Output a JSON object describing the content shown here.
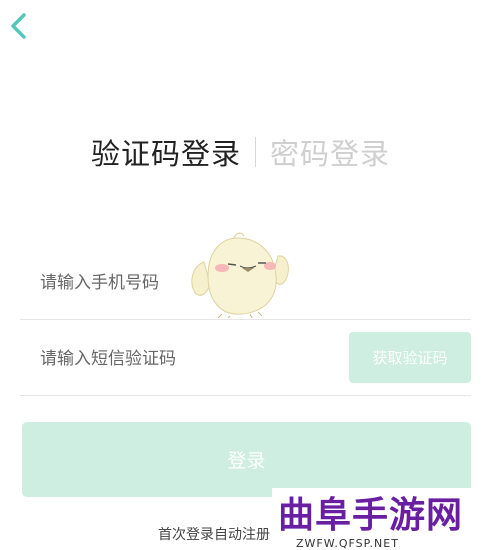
{
  "header": {
    "back_icon": "chevron-left-icon",
    "accent_color": "#54c8b8"
  },
  "tabs": [
    {
      "label": "验证码登录",
      "active": true
    },
    {
      "label": "密码登录",
      "active": false
    }
  ],
  "form": {
    "phone_placeholder": "请输入手机号码",
    "code_placeholder": "请输入短信验证码",
    "get_code_label": "获取验证码",
    "login_label": "登录",
    "button_color": "#cdeee0"
  },
  "footer": {
    "text": "首次登录自动注册"
  },
  "watermark": {
    "title": "曲阜手游网",
    "url": "ZWFW.QFSP.NET",
    "color": "#6a1fa3"
  }
}
